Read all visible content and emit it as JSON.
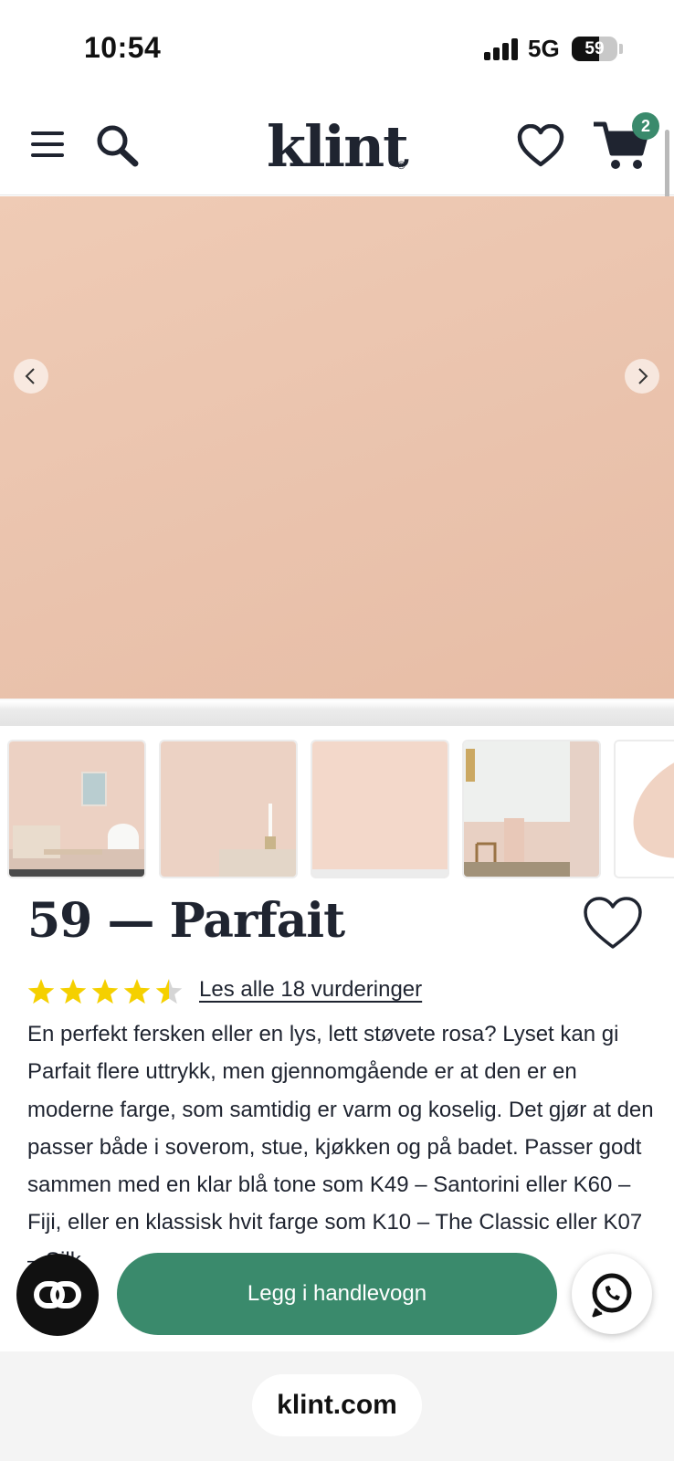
{
  "status_bar": {
    "time": "10:54",
    "network": "5G",
    "battery": "59",
    "battery_level": 0.59
  },
  "header": {
    "logo": "klint",
    "logo_mark": "®",
    "cart_count": "2",
    "icons": [
      "menu-icon",
      "search-icon",
      "heart-icon",
      "cart-icon"
    ]
  },
  "hero": {
    "color": "#ebc5ae",
    "thumbnail_count": 5
  },
  "product": {
    "title": "59 — Parfait",
    "rating": 4.5,
    "reviews_link": "Les alle 18 vurderinger",
    "description": "En perfekt fersken eller en lys, lett støvete rosa? Lyset kan gi Parfait flere uttrykk, men gjennomgående er at den er en moderne farge, som samtidig er varm og koselig. Det gjør at den passer både i soverom, stue, kjøkken og på badet. Passer godt sammen med en klar blå tone som K49 – Santorini eller K60 – Fiji, eller en klassisk hvit farge som K10 – The Classic eller K07 – Silk."
  },
  "actions": {
    "add_to_cart": "Legg i handlevogn"
  },
  "browser": {
    "url": "klint.com"
  },
  "colors": {
    "accent": "#3a8a6c",
    "text": "#1f2430",
    "star": "#f5d000"
  }
}
